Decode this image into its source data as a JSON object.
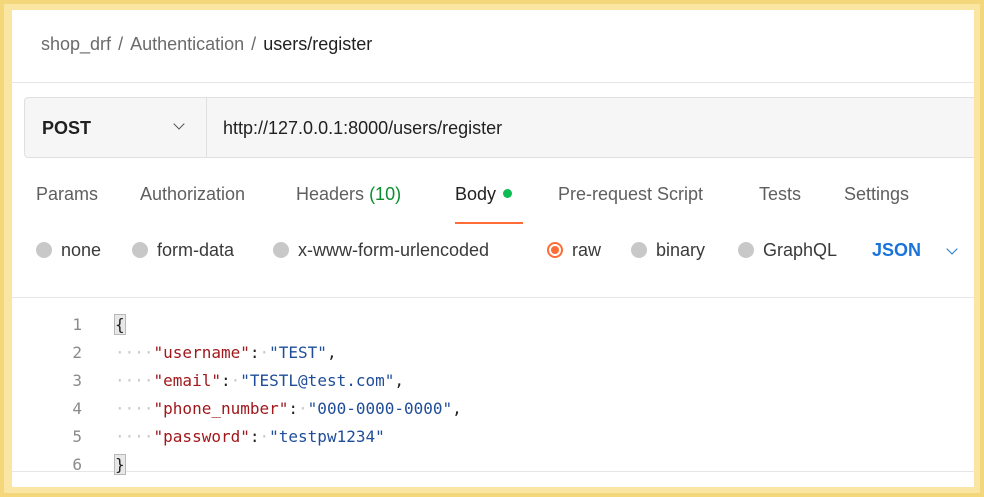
{
  "breadcrumb": {
    "items": [
      "shop_drf",
      "Authentication"
    ],
    "current": "users/register",
    "separator": "/"
  },
  "request": {
    "method": "POST",
    "url": "http://127.0.0.1:8000/users/register"
  },
  "tabs": [
    {
      "label": "Params"
    },
    {
      "label": "Authorization"
    },
    {
      "label": "Headers",
      "count": "(10)"
    },
    {
      "label": "Body",
      "active": true,
      "indicator": "green-dot"
    },
    {
      "label": "Pre-request Script"
    },
    {
      "label": "Tests"
    },
    {
      "label": "Settings"
    }
  ],
  "body_types": {
    "options": [
      "none",
      "form-data",
      "x-www-form-urlencoded",
      "raw",
      "binary",
      "GraphQL"
    ],
    "selected": "raw",
    "format": "JSON"
  },
  "editor": {
    "line_numbers": [
      "1",
      "2",
      "3",
      "4",
      "5",
      "6"
    ],
    "whitespace_marker": "····",
    "open_brace": "{",
    "close_brace": "}",
    "fields": [
      {
        "key": "\"username\"",
        "value": "\"TEST\"",
        "comma": ","
      },
      {
        "key": "\"email\"",
        "value": "\"TESTL@test.com\"",
        "comma": ","
      },
      {
        "key": "\"phone_number\"",
        "value": "\"000-0000-0000\"",
        "comma": ","
      },
      {
        "key": "\"password\"",
        "value": "\"testpw1234\"",
        "comma": ""
      }
    ]
  },
  "colors": {
    "accent_orange": "#ff6c37",
    "format_blue": "#1a73d9",
    "json_key": "#a0171c",
    "json_value": "#1f4d99",
    "active_dot": "#0cbb52",
    "frame_border": "#f4d77b"
  }
}
